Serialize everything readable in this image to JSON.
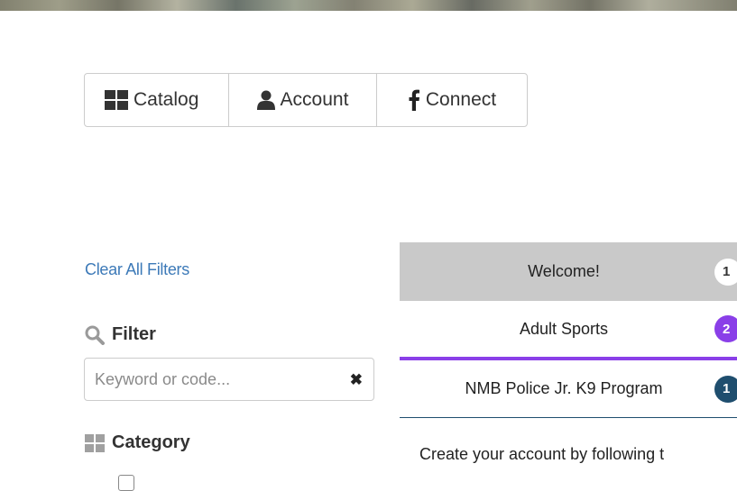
{
  "nav": {
    "catalog_label": "Catalog",
    "account_label": "Account",
    "connect_label": "Connect"
  },
  "sidebar": {
    "clear_filters": "Clear All Filters",
    "filter_heading": "Filter",
    "filter_placeholder": "Keyword or code...",
    "filter_value": "",
    "clear_glyph": "✖",
    "category_heading": "Category"
  },
  "tabs": [
    {
      "label": "Welcome!",
      "badge": "1",
      "color": "#c9c9c9"
    },
    {
      "label": "Adult Sports",
      "badge": "2",
      "color": "#8a3fe8"
    },
    {
      "label": "NMB Police Jr. K9 Program",
      "badge": "1",
      "color": "#1f4e6e"
    }
  ],
  "content": {
    "text": "Create your account by following t"
  },
  "colors": {
    "link": "#3d7ab8",
    "adult_accent": "#8a3fe8",
    "k9_accent": "#1f4e6e"
  }
}
